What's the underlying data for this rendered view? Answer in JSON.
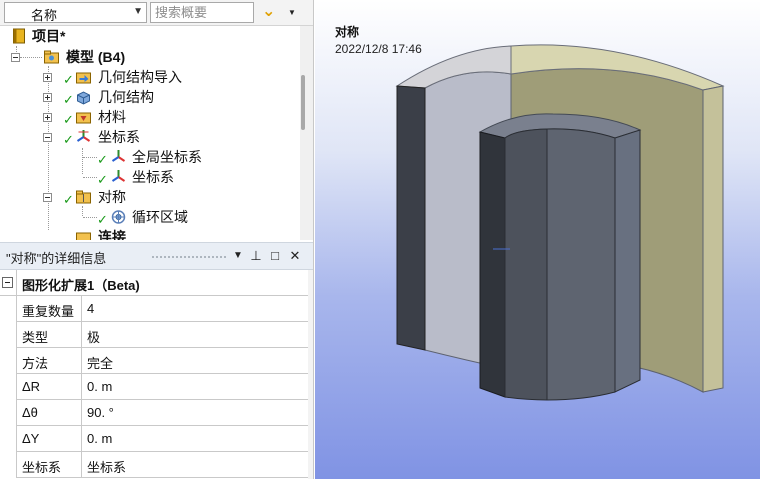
{
  "toolbar": {
    "name_select_value": "名称",
    "search_placeholder": "搜索概要"
  },
  "tree": {
    "project": "项目*",
    "model": "模型 (B4)",
    "geometry_import": "几何结构导入",
    "geometry": "几何结构",
    "materials": "材料",
    "coordinate_systems": "坐标系",
    "global_cs": "全局坐标系",
    "cs": "坐标系",
    "symmetry": "对称",
    "cyclic_region": "循环区域",
    "connections": "连接"
  },
  "details": {
    "title": "\"对称\"的详细信息",
    "pin_glyph": "ᅌ",
    "max_glyph": "□",
    "close_glyph": "✕",
    "group_label": "图形化扩展1（Beta)",
    "rows": [
      {
        "name": "重复数量",
        "value": "4"
      },
      {
        "name": "类型",
        "value": "极"
      },
      {
        "name": "方法",
        "value": "完全"
      },
      {
        "name": "ΔR",
        "value": "0. m"
      },
      {
        "name": "Δθ",
        "value": "90. °"
      },
      {
        "name": "ΔY",
        "value": "0. m"
      },
      {
        "name": "坐标系",
        "value": "坐标系"
      }
    ]
  },
  "viewport": {
    "title": "对称",
    "timestamp": "2022/12/8 17:46"
  },
  "colors": {
    "accent_check": "#1a9a1a",
    "filter_icon": "#e0a000",
    "viewport_top": "#ffffff",
    "viewport_bottom": "#8093e4"
  }
}
